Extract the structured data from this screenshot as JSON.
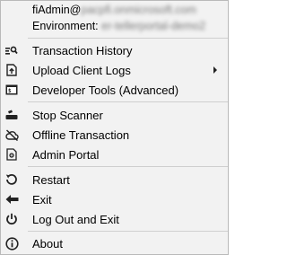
{
  "header": {
    "user_prefix": "fiAdmin@",
    "user_domain_blurred": "pacpfi.onmicrosoft.com",
    "environment_label": "Environment:",
    "environment_value_blurred": "er-tellerportal-demo2"
  },
  "menu": {
    "transaction_history": "Transaction History",
    "upload_client_logs": "Upload Client Logs",
    "developer_tools": "Developer Tools (Advanced)",
    "stop_scanner": "Stop Scanner",
    "offline_transaction": "Offline Transaction",
    "admin_portal": "Admin Portal",
    "restart": "Restart",
    "exit": "Exit",
    "logout_exit": "Log Out and Exit",
    "about": "About"
  },
  "icons": {
    "transaction_history": "search-list-icon",
    "upload_client_logs": "upload-document-icon",
    "developer_tools": "terminal-icon",
    "stop_scanner": "scanner-icon",
    "offline_transaction": "cloud-off-icon",
    "admin_portal": "document-settings-icon",
    "restart": "restart-icon",
    "exit": "arrow-left-icon",
    "logout_exit": "power-icon",
    "about": "info-icon"
  }
}
